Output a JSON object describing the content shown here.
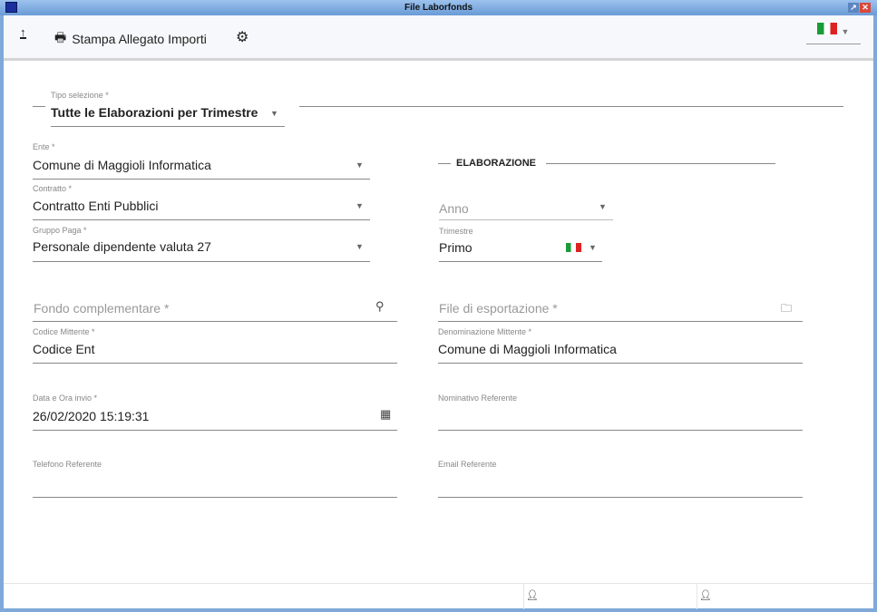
{
  "window": {
    "title": "File Laborfonds"
  },
  "toolbar": {
    "print_label": "Stampa Allegato Importi"
  },
  "form": {
    "tipo_selezione": {
      "label": "Tipo selezione *",
      "value": "Tutte le Elaborazioni per Trimestre"
    },
    "ente": {
      "label": "Ente *",
      "value": "Comune di Maggioli Informatica"
    },
    "contratto": {
      "label": "Contratto *",
      "value": "Contratto Enti Pubblici"
    },
    "gruppo_paga": {
      "label": "Gruppo Paga *",
      "value": "Personale dipendente valuta 27"
    },
    "elaborazione_title": "ELABORAZIONE",
    "anno": {
      "placeholder": "Anno"
    },
    "trimestre": {
      "label": "Trimestre",
      "value": "Primo"
    },
    "fondo": {
      "placeholder": "Fondo complementare *"
    },
    "file_export": {
      "placeholder": "File di esportazione *"
    },
    "codice_mittente": {
      "label": "Codice Mittente *",
      "value": "Codice Ent"
    },
    "denominazione": {
      "label": "Denominazione Mittente *",
      "value": "Comune di Maggioli Informatica"
    },
    "data_ora": {
      "label": "Data e Ora invio *",
      "value": "26/02/2020 15:19:31"
    },
    "nominativo": {
      "label": "Nominativo Referente",
      "value": ""
    },
    "telefono": {
      "label": "Telefono Referente",
      "value": ""
    },
    "email": {
      "label": "Email Referente",
      "value": ""
    }
  }
}
